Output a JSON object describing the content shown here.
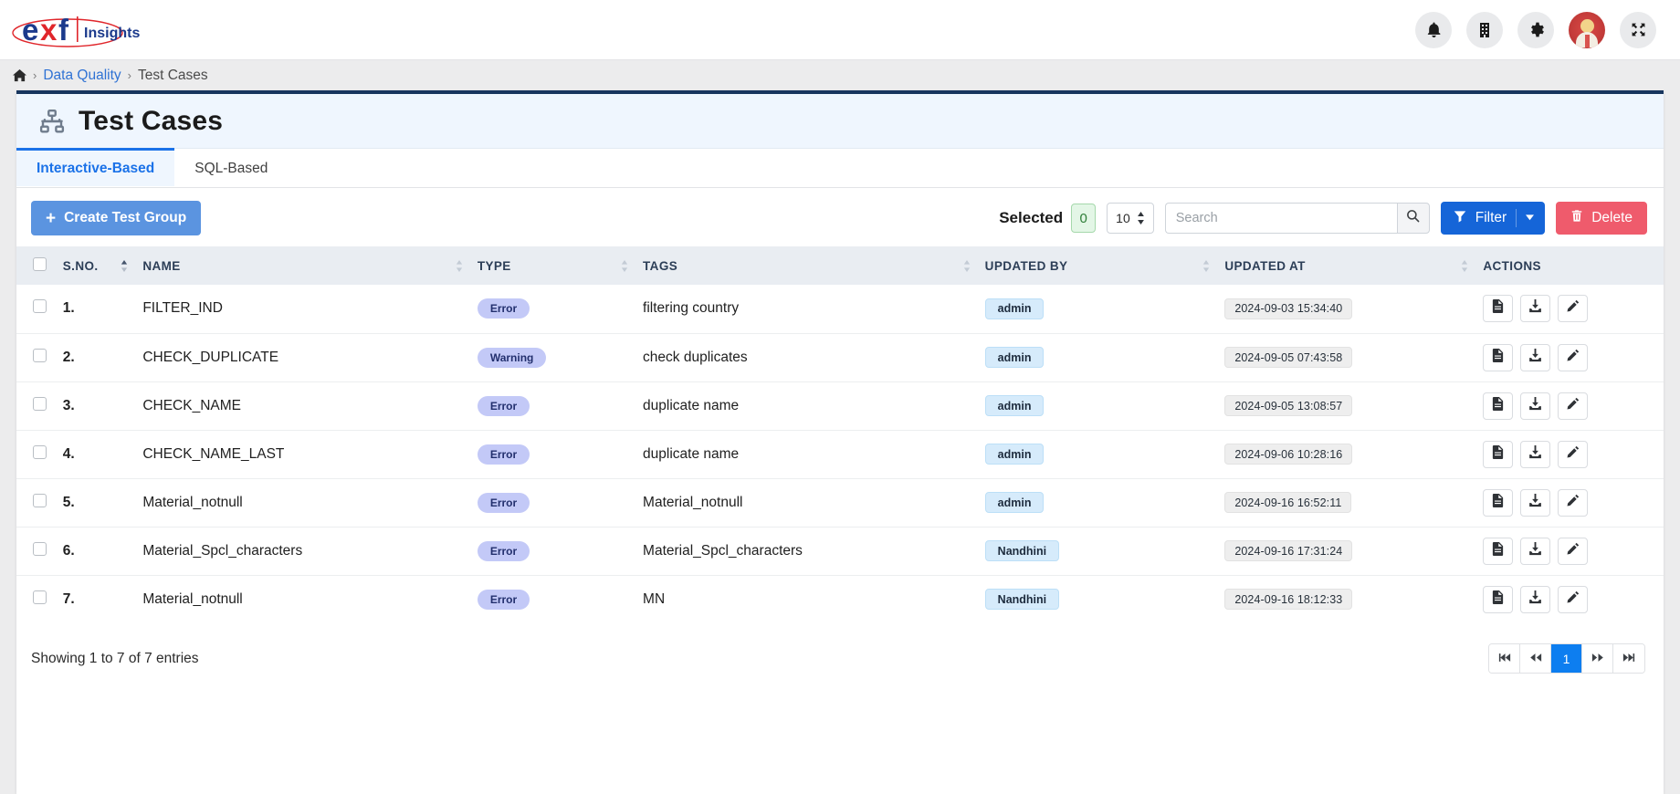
{
  "topbar": {
    "logo_main": "exf",
    "logo_sub": "Insights",
    "icons": [
      {
        "name": "notifications-icon",
        "label": "bell-icon"
      },
      {
        "name": "organization-icon",
        "label": "building-icon"
      },
      {
        "name": "settings-icon",
        "label": "gear-icon"
      },
      {
        "name": "user-avatar",
        "label": "avatar"
      },
      {
        "name": "fullscreen-icon",
        "label": "expand-icon"
      }
    ]
  },
  "breadcrumb": {
    "home_icon": "home-icon",
    "sep": "›",
    "parent": "Data Quality",
    "current": "Test Cases"
  },
  "page": {
    "icon": "sitemap-icon",
    "title": "Test Cases"
  },
  "tabs": [
    {
      "label": "Interactive-Based",
      "active": true
    },
    {
      "label": "SQL-Based",
      "active": false
    }
  ],
  "toolbar": {
    "create_label": "Create Test Group",
    "create_plus": "+",
    "selected_label": "Selected",
    "selected_count": "0",
    "page_size": "10",
    "search_placeholder": "Search",
    "search_value": "",
    "filter_label": "Filter",
    "delete_label": "Delete"
  },
  "table": {
    "columns": [
      {
        "key": "checkbox",
        "label": ""
      },
      {
        "key": "sno",
        "label": "S.NO."
      },
      {
        "key": "name",
        "label": "NAME"
      },
      {
        "key": "type",
        "label": "TYPE"
      },
      {
        "key": "tags",
        "label": "TAGS"
      },
      {
        "key": "updated_by",
        "label": "UPDATED BY"
      },
      {
        "key": "updated_at",
        "label": "UPDATED AT"
      },
      {
        "key": "actions",
        "label": "ACTIONS"
      }
    ],
    "rows": [
      {
        "sno": "1.",
        "name": "FILTER_IND",
        "type": "Error",
        "tags": "filtering country",
        "updated_by": "admin",
        "updated_at": "2024-09-03 15:34:40"
      },
      {
        "sno": "2.",
        "name": "CHECK_DUPLICATE",
        "type": "Warning",
        "tags": "check duplicates",
        "updated_by": "admin",
        "updated_at": "2024-09-05 07:43:58"
      },
      {
        "sno": "3.",
        "name": "CHECK_NAME",
        "type": "Error",
        "tags": "duplicate name",
        "updated_by": "admin",
        "updated_at": "2024-09-05 13:08:57"
      },
      {
        "sno": "4.",
        "name": "CHECK_NAME_LAST",
        "type": "Error",
        "tags": "duplicate name",
        "updated_by": "admin",
        "updated_at": "2024-09-06 10:28:16"
      },
      {
        "sno": "5.",
        "name": "Material_notnull",
        "type": "Error",
        "tags": "Material_notnull",
        "updated_by": "admin",
        "updated_at": "2024-09-16 16:52:11"
      },
      {
        "sno": "6.",
        "name": "Material_Spcl_characters",
        "type": "Error",
        "tags": "Material_Spcl_characters",
        "updated_by": "Nandhini",
        "updated_at": "2024-09-16 17:31:24"
      },
      {
        "sno": "7.",
        "name": "Material_notnull",
        "type": "Error",
        "tags": "MN",
        "updated_by": "Nandhini",
        "updated_at": "2024-09-16 18:12:33"
      }
    ],
    "row_actions": [
      {
        "name": "view-report-icon"
      },
      {
        "name": "download-icon"
      },
      {
        "name": "edit-icon"
      }
    ]
  },
  "footer": {
    "showing": "Showing 1 to 7 of 7 entries",
    "pager": [
      {
        "name": "pager-first",
        "glyph": "⏮",
        "active": false
      },
      {
        "name": "pager-prev",
        "glyph": "◀◀",
        "active": false
      },
      {
        "name": "pager-page-1",
        "glyph": "1",
        "active": true
      },
      {
        "name": "pager-next",
        "glyph": "▶▶",
        "active": false
      },
      {
        "name": "pager-last",
        "glyph": "⏭",
        "active": false
      }
    ]
  },
  "colors": {
    "accent_blue": "#1565d8",
    "card_top_border": "#17355e",
    "danger_red": "#ef5b6c",
    "create_blue": "#5b94e0",
    "pill_purple": "#c3c9f7"
  }
}
